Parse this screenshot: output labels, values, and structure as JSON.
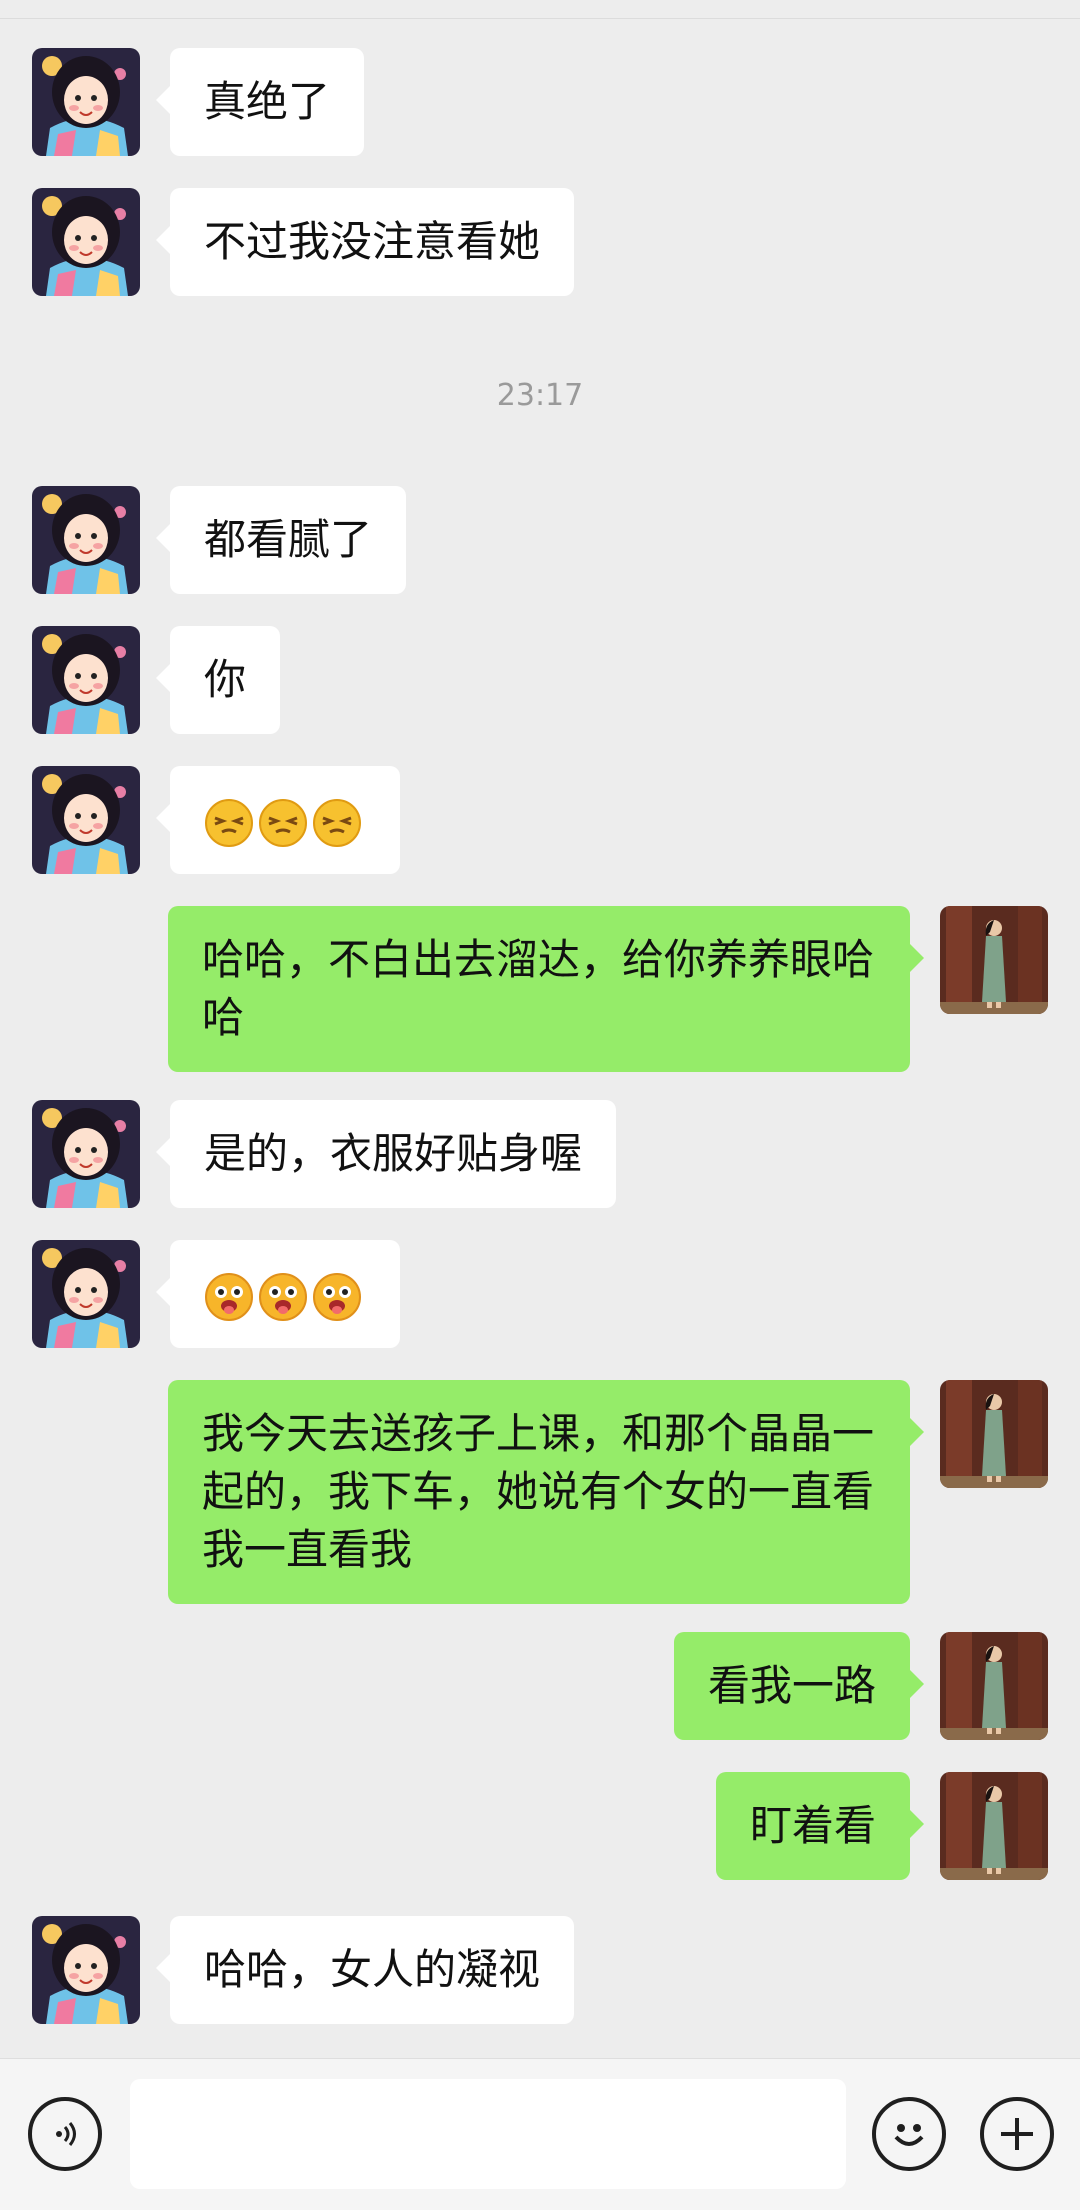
{
  "messages": [
    {
      "side": "left",
      "text": "真绝了"
    },
    {
      "side": "left",
      "text": "不过我没注意看她"
    },
    {
      "time": "23:17"
    },
    {
      "side": "left",
      "text": "都看腻了"
    },
    {
      "side": "left",
      "text": "你"
    },
    {
      "side": "left",
      "emoji": [
        "smirk",
        "smirk",
        "smirk"
      ]
    },
    {
      "side": "right",
      "text": "哈哈，不白出去溜达，给你养养眼哈哈"
    },
    {
      "side": "left",
      "text": "是的，衣服好贴身喔"
    },
    {
      "side": "left",
      "emoji": [
        "drool",
        "drool",
        "drool"
      ]
    },
    {
      "side": "right",
      "text": "我今天去送孩子上课，和那个晶晶一起的，我下车，她说有个女的一直看我一直看我"
    },
    {
      "side": "right",
      "text": "看我一路"
    },
    {
      "side": "right",
      "text": "盯着看"
    },
    {
      "side": "left",
      "text": "哈哈，女人的凝视"
    }
  ],
  "colors": {
    "background": "#ededed",
    "incoming_bubble": "#ffffff",
    "outgoing_bubble": "#95ec69",
    "timestamp": "#9a9a9a"
  },
  "input_bar": {
    "voice_icon": "voice-icon",
    "emoji_icon": "emoji-smile-icon",
    "more_icon": "plus-icon",
    "text_value": ""
  }
}
